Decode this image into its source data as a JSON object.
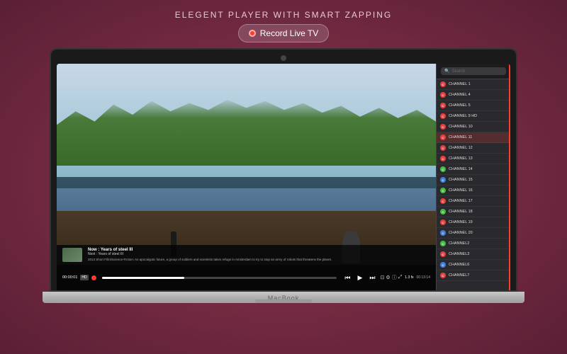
{
  "header": {
    "title": "ELEGENT PLAYER WITH SMART ZAPPING",
    "record_badge_label": "Record Live TV"
  },
  "controls": {
    "time_start": "00:00:01",
    "time_end": "1.3 fs",
    "clock": "00:13:14",
    "hd_label": "HD",
    "rec_indicator": "●"
  },
  "video": {
    "title": "Now : Years of steel III",
    "next": "Next : Years of steel III",
    "description": "2013 Short Film/Science-Fiction: An apocalyptic future, a group of soldiers and scientists takes refuge in Amsterdam to try to stop an army of robots that threatens the planet."
  },
  "sidebar": {
    "search_placeholder": "Search",
    "channels": [
      {
        "name": "CHANNEL 1",
        "color": "#e84040",
        "active": false
      },
      {
        "name": "CHANNEL 4",
        "color": "#e84040",
        "active": false
      },
      {
        "name": "CHANNEL 5",
        "color": "#e84040",
        "active": false
      },
      {
        "name": "CHANNEL 9 HD",
        "color": "#e84040",
        "active": false
      },
      {
        "name": "CHANNEL 10",
        "color": "#e84040",
        "active": false
      },
      {
        "name": "CHANNEL 11",
        "color": "#e84040",
        "active": true
      },
      {
        "name": "CHANNEL 12",
        "color": "#e84040",
        "active": false
      },
      {
        "name": "CHANNEL 13",
        "color": "#e84040",
        "active": false
      },
      {
        "name": "CHANNEL 14",
        "color": "#40c040",
        "active": false
      },
      {
        "name": "CHANNEL 15",
        "color": "#4080e0",
        "active": false
      },
      {
        "name": "CHANNEL 16",
        "color": "#40c040",
        "active": false
      },
      {
        "name": "CHANNEL 17",
        "color": "#e84040",
        "active": false
      },
      {
        "name": "CHANNEL 18",
        "color": "#40c040",
        "active": false
      },
      {
        "name": "CHANNEL 19",
        "color": "#e84040",
        "active": false
      },
      {
        "name": "CHANNEL 20",
        "color": "#4080e0",
        "active": false
      },
      {
        "name": "CHANNEL2",
        "color": "#40c040",
        "active": false
      },
      {
        "name": "CHANNEL3",
        "color": "#e84040",
        "active": false
      },
      {
        "name": "CHANNEL6",
        "color": "#4080e0",
        "active": false
      },
      {
        "name": "CHANNEL7",
        "color": "#e84040",
        "active": false
      }
    ]
  },
  "laptop": {
    "brand": "MacBook"
  }
}
